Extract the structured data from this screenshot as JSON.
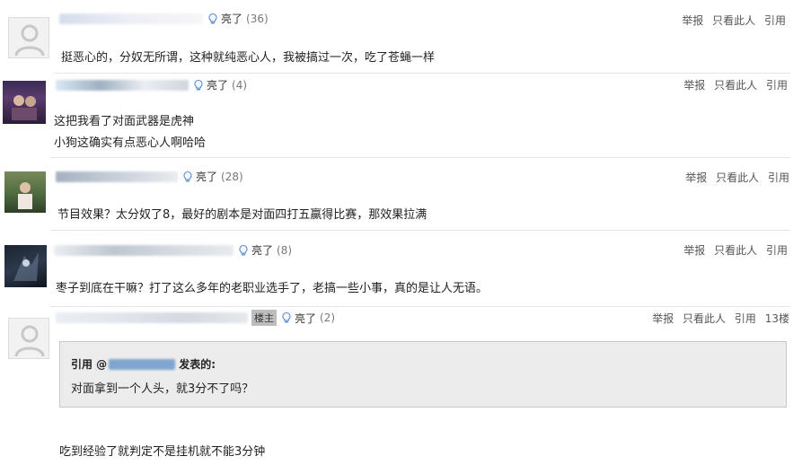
{
  "comments": [
    {
      "avatar": "default-avatar",
      "like_label": "亮了",
      "like_count": "(36)",
      "actions": [
        "举报",
        "只看此人",
        "引用"
      ],
      "lines": [
        "挺恶心的，分奴无所谓，这种就纯恶心人，我被搞过一次，吃了苍蝇一样"
      ]
    },
    {
      "avatar": "photo-avatar",
      "like_label": "亮了",
      "like_count": "(4)",
      "actions": [
        "举报",
        "只看此人",
        "引用"
      ],
      "lines": [
        "这把我看了对面武器是虎神",
        "小狗这确实有点恶心人啊哈哈"
      ]
    },
    {
      "avatar": "photo-avatar",
      "username_fragment": "sxijk 2019 11",
      "like_label": "亮了",
      "like_count": "(28)",
      "actions": [
        "举报",
        "只看此人",
        "引用"
      ],
      "lines": [
        "节目效果？太分奴了8，最好的剧本是对面四打五赢得比赛，那效果拉满"
      ]
    },
    {
      "avatar": "photo-avatar",
      "like_label": "亮了",
      "like_count": "(8)",
      "actions": [
        "举报",
        "只看此人",
        "引用"
      ],
      "lines": [
        "枣子到底在干嘛？打了这么多年的老职业选手了，老搞一些小事，真的是让人无语。"
      ]
    },
    {
      "avatar": "default-avatar",
      "owner_tag": "楼主",
      "like_label": "亮了",
      "like_count": "(2)",
      "actions": [
        "举报",
        "只看此人",
        "引用"
      ],
      "floor": "13楼",
      "quote": {
        "prefix": "引用 @",
        "suffix": "发表的:",
        "text": "对面拿到一个人头，就3分不了吗？"
      },
      "lines": [
        "吃到经验了就判定不是挂机就不能3分钟"
      ]
    }
  ],
  "colors": {
    "divider": "#e6e6e6",
    "quote_bg": "#ececec",
    "meta_text": "#666666"
  }
}
